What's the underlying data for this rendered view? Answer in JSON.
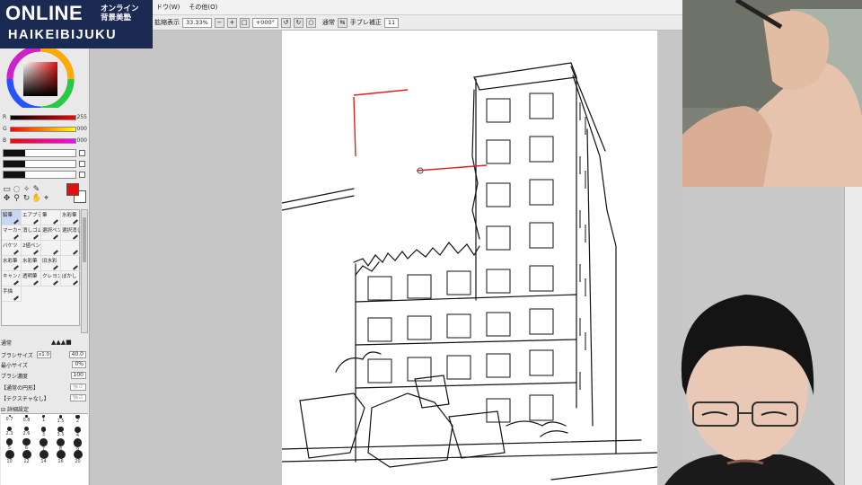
{
  "logo": {
    "line1": "ONLINE",
    "line2_a": "オンライン",
    "line2_b": "背景美塾",
    "line3": "HAIKEIBIJUKU"
  },
  "menubar": {
    "items": [
      "ドウ(W)",
      "その他(O)"
    ]
  },
  "toolbar": {
    "zoom_label": "拡縮表示",
    "zoom_value": "33.33%",
    "angle_value": "+000°",
    "blend_label": "通常",
    "stabilizer_label": "手ブレ補正",
    "stabilizer_value": "11"
  },
  "color": {
    "r_label": "R",
    "r_value": "255",
    "g_label": "G",
    "g_value": "000",
    "b_label": "B",
    "b_value": "000",
    "foreground": "#e01010",
    "background": "#ffffff"
  },
  "brushes": [
    {
      "label": "鉛筆",
      "selected": true
    },
    {
      "label": "エアブラシ",
      "selected": false
    },
    {
      "label": "筆",
      "selected": false
    },
    {
      "label": "水彩筆",
      "selected": false
    },
    {
      "label": "マーカー",
      "selected": false
    },
    {
      "label": "消しゴム",
      "selected": false
    },
    {
      "label": "選択ペン",
      "selected": false
    },
    {
      "label": "選択消し",
      "selected": false
    },
    {
      "label": "バケツ",
      "selected": false
    },
    {
      "label": "2値ペン",
      "selected": false
    },
    {
      "label": "",
      "selected": false
    },
    {
      "label": "",
      "selected": false
    },
    {
      "label": "水彩筆",
      "selected": false
    },
    {
      "label": "水彩筆",
      "selected": false
    },
    {
      "label": "旧水彩",
      "selected": false
    },
    {
      "label": "",
      "selected": false
    },
    {
      "label": "キャンバス",
      "selected": false
    },
    {
      "label": "透明筆",
      "selected": false
    },
    {
      "label": "クレヨン",
      "selected": false
    },
    {
      "label": "ぼかし",
      "selected": false
    },
    {
      "label": "手描",
      "selected": false
    }
  ],
  "props": {
    "mode_label": "通常",
    "size_label": "ブラシサイズ",
    "size_mult": "x1.0",
    "size_value": "40.0",
    "min_label": "最小サイズ",
    "min_value": "0%",
    "density_label": "ブラシ濃度",
    "density_value": "100",
    "shape_label": "【通常の円形】",
    "texture_label": "【テクスチャなし】",
    "detail_label": "詳細設定",
    "shape_strength": "強さ",
    "texture_strength": "強さ"
  },
  "size_presets": [
    "0.7",
    "0.8",
    "1",
    "1.5",
    "2",
    "2.3",
    "2.6",
    "3",
    "3.5",
    "4",
    "5",
    "6",
    "7",
    "8",
    "9",
    "10",
    "12",
    "14",
    "16",
    "20"
  ],
  "canvas": {
    "guide_color": "#e02020"
  }
}
